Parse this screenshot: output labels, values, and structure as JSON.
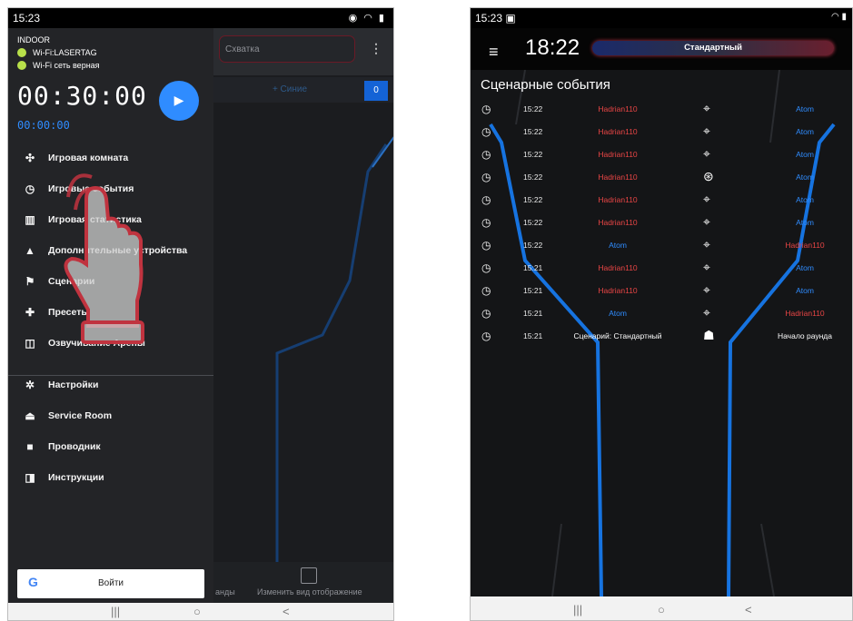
{
  "left": {
    "status_time": "15:23",
    "status_icons": "◉ ◠ ▮",
    "background": {
      "search_text": "Схватка",
      "team_text": "+ Синие",
      "team_count": "0",
      "bottom_left": "анды",
      "bottom_right": "Изменить вид отображение"
    },
    "drawer": {
      "environment": "INDOOR",
      "wifi_name": "Wi-Fi:LASERTAG",
      "wifi_status": "Wi-Fi сеть верная",
      "main_timer": "00:30:00",
      "elapsed_timer": "00:00:00",
      "items": [
        {
          "label": "Игровая комната",
          "icon": "gamepad-icon"
        },
        {
          "label": "Игровые события",
          "icon": "timer-icon"
        },
        {
          "label": "Игровая статистика",
          "icon": "bar-chart-icon"
        },
        {
          "label": "Дополнительные устройства",
          "icon": "devices-icon"
        },
        {
          "label": "Сценарии",
          "icon": "flag-icon"
        },
        {
          "label": "Пресеты",
          "icon": "puzzle-icon"
        },
        {
          "label": "Озвучивание Арены",
          "icon": "audio-icon"
        },
        {
          "label": "Настройки",
          "icon": "gear-icon"
        },
        {
          "label": "Service Room",
          "icon": "bell-icon"
        },
        {
          "label": "Проводник",
          "icon": "folder-icon"
        },
        {
          "label": "Инструкции",
          "icon": "book-icon"
        }
      ],
      "login_label": "Войти",
      "login_icon": "G"
    },
    "nav": {
      "recent": "|||",
      "home": "○",
      "back": "<"
    }
  },
  "right": {
    "status_time": "15:23 ▣",
    "status_icons": "◠ ▮",
    "clock": "18:22",
    "scenario": "Стандартный",
    "title": "Сценарные события",
    "events": [
      {
        "time": "15:22",
        "a": "Hadrian110",
        "a_color": "red",
        "mark": "⌖",
        "b": "Atom",
        "b_color": "blue"
      },
      {
        "time": "15:22",
        "a": "Hadrian110",
        "a_color": "red",
        "mark": "⌖",
        "b": "Atom",
        "b_color": "blue"
      },
      {
        "time": "15:22",
        "a": "Hadrian110",
        "a_color": "red",
        "mark": "⌖",
        "b": "Atom",
        "b_color": "blue"
      },
      {
        "time": "15:22",
        "a": "Hadrian110",
        "a_color": "red",
        "mark": "⊛",
        "b": "Atom",
        "b_color": "blue"
      },
      {
        "time": "15:22",
        "a": "Hadrian110",
        "a_color": "red",
        "mark": "⌖",
        "b": "Atom",
        "b_color": "blue"
      },
      {
        "time": "15:22",
        "a": "Hadrian110",
        "a_color": "red",
        "mark": "⌖",
        "b": "Atom",
        "b_color": "blue"
      },
      {
        "time": "15:22",
        "a": "Atom",
        "a_color": "blue",
        "mark": "⌖",
        "b": "Hadrian110",
        "b_color": "red"
      },
      {
        "time": "15:21",
        "a": "Hadrian110",
        "a_color": "red",
        "mark": "⌖",
        "b": "Atom",
        "b_color": "blue"
      },
      {
        "time": "15:21",
        "a": "Hadrian110",
        "a_color": "red",
        "mark": "⌖",
        "b": "Atom",
        "b_color": "blue"
      },
      {
        "time": "15:21",
        "a": "Atom",
        "a_color": "blue",
        "mark": "⌖",
        "b": "Hadrian110",
        "b_color": "red"
      },
      {
        "time": "15:21",
        "a": "Сценарий: Стандартный",
        "a_color": "white",
        "mark": "☗",
        "b": "Начало раунда",
        "b_color": "white"
      }
    ],
    "nav": {
      "recent": "|||",
      "home": "○",
      "back": "<"
    }
  },
  "colors": {
    "accent_blue": "#2f8cff",
    "red": "#e84545",
    "green_dot": "#b8e04a",
    "hand_outline": "#c0333f"
  }
}
